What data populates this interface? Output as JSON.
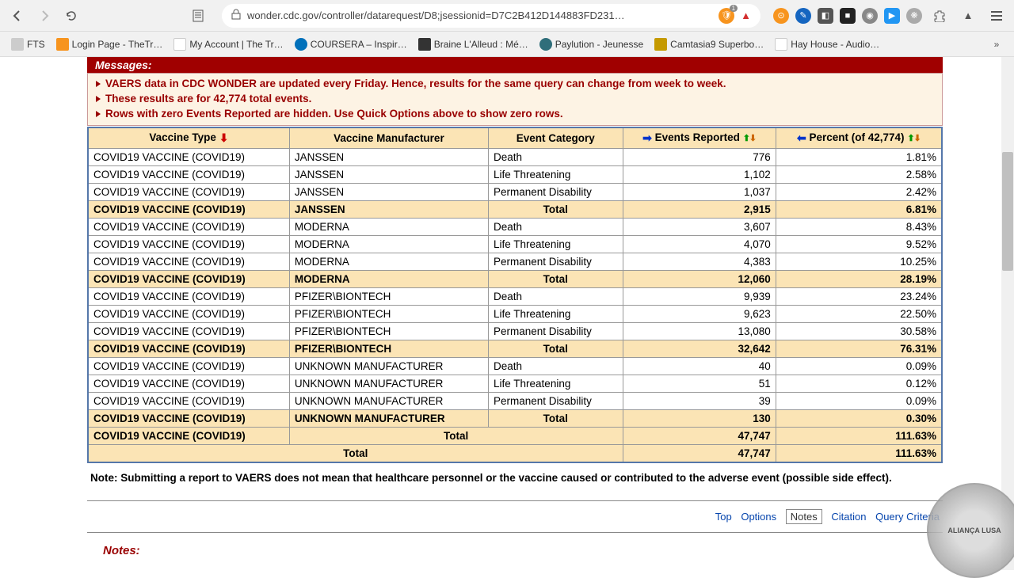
{
  "browser": {
    "url": "wonder.cdc.gov/controller/datarequest/D8;jsessionid=D7C2B412D144883FD231…",
    "bookmarks": [
      {
        "label": "FTS"
      },
      {
        "label": "Login Page - TheTr…"
      },
      {
        "label": "My Account | The Tr…"
      },
      {
        "label": "COURSERA – Inspir…"
      },
      {
        "label": "Braine L'Alleud : Mé…"
      },
      {
        "label": "Paylution - Jeunesse"
      },
      {
        "label": "Camtasia9 Superbo…"
      },
      {
        "label": "Hay House - Audio…"
      }
    ]
  },
  "messages": {
    "header": "Messages:",
    "lines": [
      "VAERS data in CDC WONDER are updated every Friday. Hence, results for the same query can change from week to week.",
      "These results are for 42,774 total events.",
      "Rows with zero Events Reported are hidden. Use Quick Options above to show zero rows."
    ]
  },
  "table": {
    "headers": {
      "c0": "Vaccine Type",
      "c1": "Vaccine Manufacturer",
      "c2": "Event Category",
      "c3": "Events Reported",
      "c4": "Percent (of 42,774)"
    },
    "rows": [
      {
        "vt": "COVID19 VACCINE (COVID19)",
        "mfr": "JANSSEN",
        "cat": "Death",
        "ev": "776",
        "pct": "1.81%",
        "total": false
      },
      {
        "vt": "COVID19 VACCINE (COVID19)",
        "mfr": "JANSSEN",
        "cat": "Life Threatening",
        "ev": "1,102",
        "pct": "2.58%",
        "total": false
      },
      {
        "vt": "COVID19 VACCINE (COVID19)",
        "mfr": "JANSSEN",
        "cat": "Permanent Disability",
        "ev": "1,037",
        "pct": "2.42%",
        "total": false
      },
      {
        "vt": "COVID19 VACCINE (COVID19)",
        "mfr": "JANSSEN",
        "cat": "Total",
        "ev": "2,915",
        "pct": "6.81%",
        "total": true
      },
      {
        "vt": "COVID19 VACCINE (COVID19)",
        "mfr": "MODERNA",
        "cat": "Death",
        "ev": "3,607",
        "pct": "8.43%",
        "total": false
      },
      {
        "vt": "COVID19 VACCINE (COVID19)",
        "mfr": "MODERNA",
        "cat": "Life Threatening",
        "ev": "4,070",
        "pct": "9.52%",
        "total": false
      },
      {
        "vt": "COVID19 VACCINE (COVID19)",
        "mfr": "MODERNA",
        "cat": "Permanent Disability",
        "ev": "4,383",
        "pct": "10.25%",
        "total": false
      },
      {
        "vt": "COVID19 VACCINE (COVID19)",
        "mfr": "MODERNA",
        "cat": "Total",
        "ev": "12,060",
        "pct": "28.19%",
        "total": true
      },
      {
        "vt": "COVID19 VACCINE (COVID19)",
        "mfr": "PFIZER\\BIONTECH",
        "cat": "Death",
        "ev": "9,939",
        "pct": "23.24%",
        "total": false
      },
      {
        "vt": "COVID19 VACCINE (COVID19)",
        "mfr": "PFIZER\\BIONTECH",
        "cat": "Life Threatening",
        "ev": "9,623",
        "pct": "22.50%",
        "total": false
      },
      {
        "vt": "COVID19 VACCINE (COVID19)",
        "mfr": "PFIZER\\BIONTECH",
        "cat": "Permanent Disability",
        "ev": "13,080",
        "pct": "30.58%",
        "total": false
      },
      {
        "vt": "COVID19 VACCINE (COVID19)",
        "mfr": "PFIZER\\BIONTECH",
        "cat": "Total",
        "ev": "32,642",
        "pct": "76.31%",
        "total": true
      },
      {
        "vt": "COVID19 VACCINE (COVID19)",
        "mfr": "UNKNOWN MANUFACTURER",
        "cat": "Death",
        "ev": "40",
        "pct": "0.09%",
        "total": false
      },
      {
        "vt": "COVID19 VACCINE (COVID19)",
        "mfr": "UNKNOWN MANUFACTURER",
        "cat": "Life Threatening",
        "ev": "51",
        "pct": "0.12%",
        "total": false
      },
      {
        "vt": "COVID19 VACCINE (COVID19)",
        "mfr": "UNKNOWN MANUFACTURER",
        "cat": "Permanent Disability",
        "ev": "39",
        "pct": "0.09%",
        "total": false
      },
      {
        "vt": "COVID19 VACCINE (COVID19)",
        "mfr": "UNKNOWN MANUFACTURER",
        "cat": "Total",
        "ev": "130",
        "pct": "0.30%",
        "total": true
      }
    ],
    "vt_total": {
      "vt": "COVID19 VACCINE (COVID19)",
      "label": "Total",
      "ev": "47,747",
      "pct": "111.63%"
    },
    "grand_total": {
      "label": "Total",
      "ev": "47,747",
      "pct": "111.63%"
    }
  },
  "note": "Note: Submitting a report to VAERS does not mean that healthcare personnel or the vaccine caused or contributed to the adverse event (possible side effect).",
  "links": {
    "top": "Top",
    "options": "Options",
    "notes": "Notes",
    "citation": "Citation",
    "query": "Query Criteria"
  },
  "notes_header": "Notes:",
  "watermark": "ALIANÇA LUSA"
}
